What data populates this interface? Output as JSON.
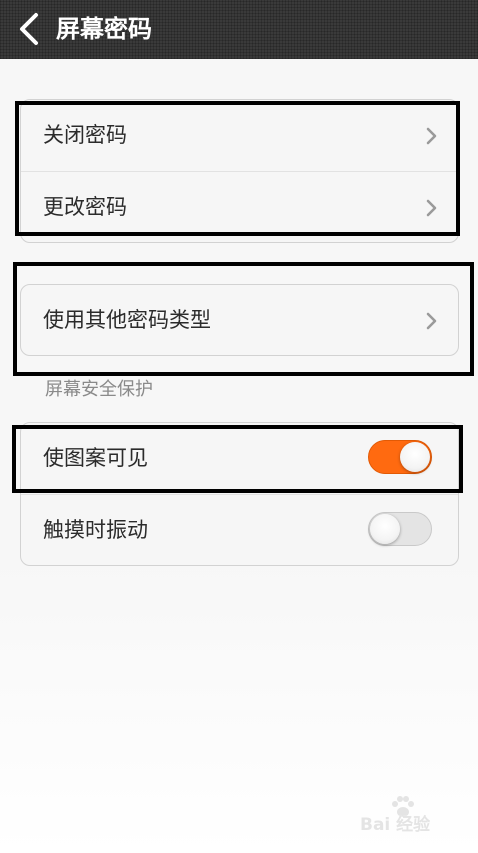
{
  "header": {
    "title": "屏幕密码",
    "back_icon": "chevron-left-icon"
  },
  "password_group": {
    "items": [
      {
        "label": "关闭密码",
        "icon": "chevron-right-icon"
      },
      {
        "label": "更改密码",
        "icon": "chevron-right-icon"
      }
    ]
  },
  "other_type": {
    "label": "使用其他密码类型",
    "icon": "chevron-right-icon"
  },
  "security_section": {
    "title": "屏幕安全保护",
    "items": [
      {
        "label": "使图案可见",
        "toggle": true
      },
      {
        "label": "触摸时振动",
        "toggle": false
      }
    ]
  },
  "watermark": {
    "text": "Bai 经验"
  },
  "colors": {
    "header_bg": "#3a3a3a",
    "toggle_on": "#ff6a10",
    "toggle_off": "#e4e4e4",
    "highlight": "#000000"
  }
}
